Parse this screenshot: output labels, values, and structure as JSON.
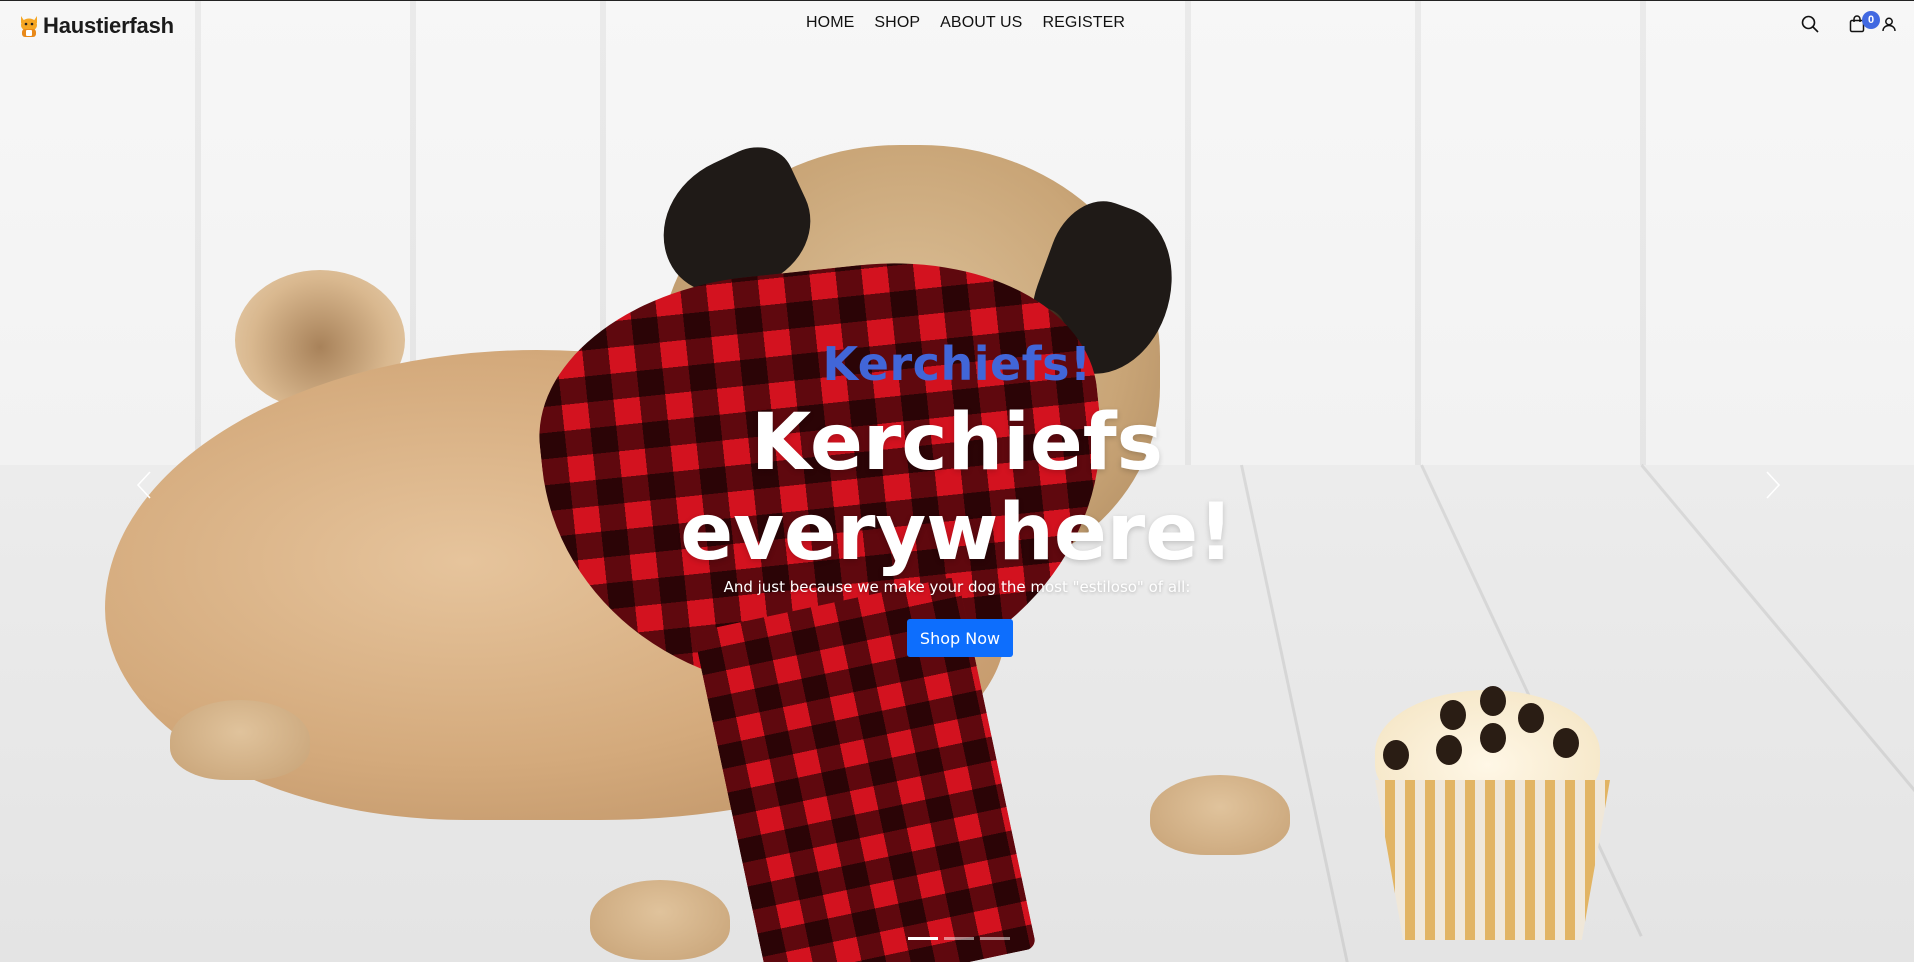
{
  "brand": {
    "name": "Haustierfash",
    "logo_icon": "cat-icon"
  },
  "nav": {
    "items": [
      {
        "label": "HOME"
      },
      {
        "label": "SHOP"
      },
      {
        "label": "ABOUT US"
      },
      {
        "label": "REGISTER"
      }
    ]
  },
  "header_icons": {
    "search_icon": "search-icon",
    "cart_icon": "shopping-bag-icon",
    "cart_count": "0",
    "account_icon": "user-icon",
    "badge_color": "#4169e1"
  },
  "hero": {
    "eyebrow": "Kerchiefs!",
    "headline_line1": "Kerchiefs",
    "headline_line2": "everywhere!",
    "subline": "And just because we make your dog the most \"estiloso\" of all:",
    "cta_label": "Shop Now",
    "eyebrow_color": "#4166d8",
    "cta_color": "#0d6efd",
    "prev_icon": "chevron-left-icon",
    "next_icon": "chevron-right-icon",
    "slides_total": 3,
    "active_slide": 1
  }
}
